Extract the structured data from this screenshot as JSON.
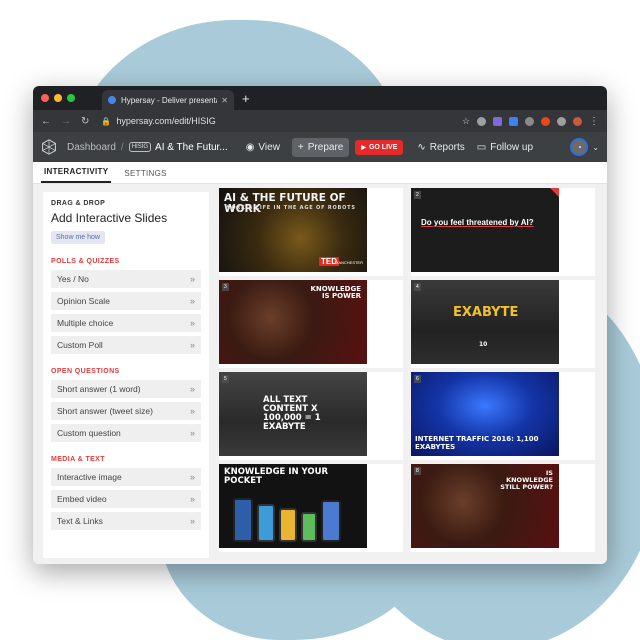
{
  "browser": {
    "tab_title": "Hypersay - Deliver presentati...",
    "url": "hypersay.com/edit/HISIG"
  },
  "app": {
    "dashboard": "Dashboard",
    "deck_badge": "HISIG",
    "deck_title": "AI & The Futur...",
    "view": "View",
    "prepare": "Prepare",
    "go_live": "GO LIVE",
    "reports": "Reports",
    "follow_up": "Follow up"
  },
  "subtabs": [
    "INTERACTIVITY",
    "SETTINGS"
  ],
  "sidebar": {
    "kicker": "DRAG & DROP",
    "title": "Add Interactive Slides",
    "show_me": "Show me how",
    "sections": [
      {
        "title": "POLLS & QUIZZES",
        "items": [
          "Yes / No",
          "Opinion Scale",
          "Multiple choice",
          "Custom Poll"
        ]
      },
      {
        "title": "OPEN QUESTIONS",
        "items": [
          "Short answer (1 word)",
          "Short answer (tweet size)",
          "Custom question"
        ]
      },
      {
        "title": "MEDIA & TEXT",
        "items": [
          "Interactive image",
          "Embed video",
          "Text & Links"
        ]
      }
    ]
  },
  "slides": [
    {
      "num": "1",
      "line1": "AI & THE FUTURE OF WORK",
      "line2": "WORK & LIFE IN THE AGE OF ROBOTS",
      "tag": "TED",
      "tag2": "MANCHESTER"
    },
    {
      "num": "2",
      "text": "Do you feel threatened by AI?"
    },
    {
      "num": "3",
      "text": "KNOWLEDGE IS POWER"
    },
    {
      "num": "4",
      "text": "EXABYTE",
      "sub": "10"
    },
    {
      "num": "5",
      "text": "ALL TEXT CONTENT X 100,000 = 1 EXABYTE"
    },
    {
      "num": "6",
      "text": "INTERNET TRAFFIC 2016: 1,100 EXABYTES"
    },
    {
      "num": "7",
      "text": "KNOWLEDGE IN YOUR POCKET"
    },
    {
      "num": "8",
      "text": "IS KNOWLEDGE STILL POWER?"
    }
  ],
  "colors": {
    "accent": "#e52a2a",
    "header": "#3c4043",
    "backdrop": "#a9cbd9"
  }
}
